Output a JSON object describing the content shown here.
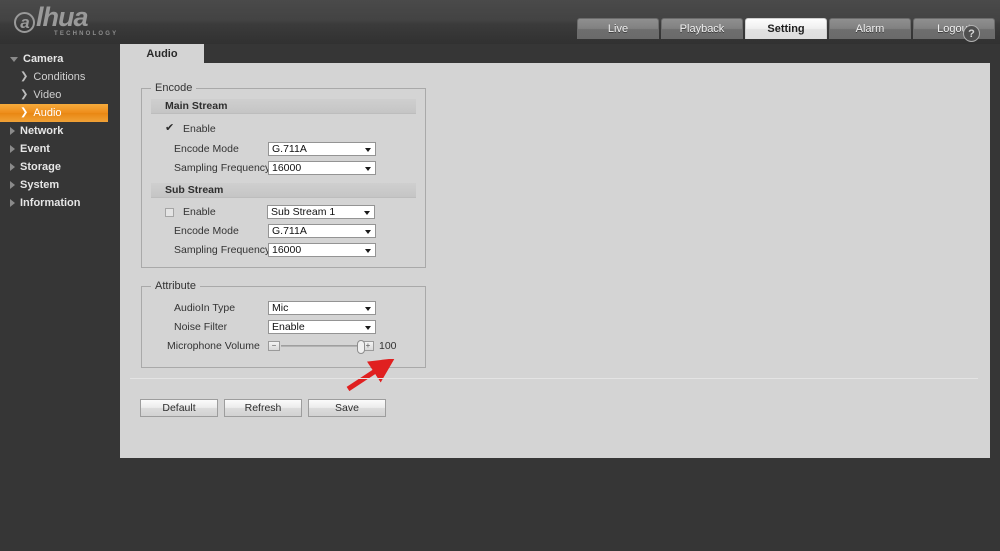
{
  "brand": {
    "logo_a": "a",
    "logo_text": "lhua",
    "logo_sub": "TECHNOLOGY"
  },
  "topnav": {
    "tabs": [
      {
        "label": "Live",
        "active": false
      },
      {
        "label": "Playback",
        "active": false
      },
      {
        "label": "Setting",
        "active": true
      },
      {
        "label": "Alarm",
        "active": false
      },
      {
        "label": "Logout",
        "active": false
      }
    ]
  },
  "sidebar": {
    "items": [
      {
        "label": "Camera",
        "level": "top",
        "expanded": true,
        "selected": false
      },
      {
        "label": "Conditions",
        "level": "child",
        "selected": false
      },
      {
        "label": "Video",
        "level": "child",
        "selected": false
      },
      {
        "label": "Audio",
        "level": "child",
        "selected": true
      },
      {
        "label": "Network",
        "level": "top",
        "expanded": false,
        "selected": false
      },
      {
        "label": "Event",
        "level": "top",
        "expanded": false,
        "selected": false
      },
      {
        "label": "Storage",
        "level": "top",
        "expanded": false,
        "selected": false
      },
      {
        "label": "System",
        "level": "top",
        "expanded": false,
        "selected": false
      },
      {
        "label": "Information",
        "level": "top",
        "expanded": false,
        "selected": false
      }
    ]
  },
  "content": {
    "tab_label": "Audio",
    "help_icon": "question-mark-icon",
    "encode": {
      "legend": "Encode",
      "main_stream": {
        "header": "Main Stream",
        "enable_label": "Enable",
        "enable_checked": true,
        "encode_mode_label": "Encode Mode",
        "encode_mode_value": "G.711A",
        "sampling_label": "Sampling Frequency",
        "sampling_value": "16000"
      },
      "sub_stream": {
        "header": "Sub Stream",
        "enable_label": "Enable",
        "enable_checked": false,
        "stream_select_value": "Sub Stream 1",
        "encode_mode_label": "Encode Mode",
        "encode_mode_value": "G.711A",
        "sampling_label": "Sampling Frequency",
        "sampling_value": "16000"
      }
    },
    "attribute": {
      "legend": "Attribute",
      "audioin_label": "AudioIn Type",
      "audioin_value": "Mic",
      "noise_label": "Noise Filter",
      "noise_value": "Enable",
      "volume_label": "Microphone Volume",
      "volume_value": "100",
      "volume_minus": "−",
      "volume_plus": "+"
    },
    "buttons": [
      {
        "label": "Default"
      },
      {
        "label": "Refresh"
      },
      {
        "label": "Save"
      }
    ]
  },
  "annotation": {
    "type": "red-arrow",
    "color": "#e02020",
    "points_to": "AudioIn Type dropdown"
  }
}
